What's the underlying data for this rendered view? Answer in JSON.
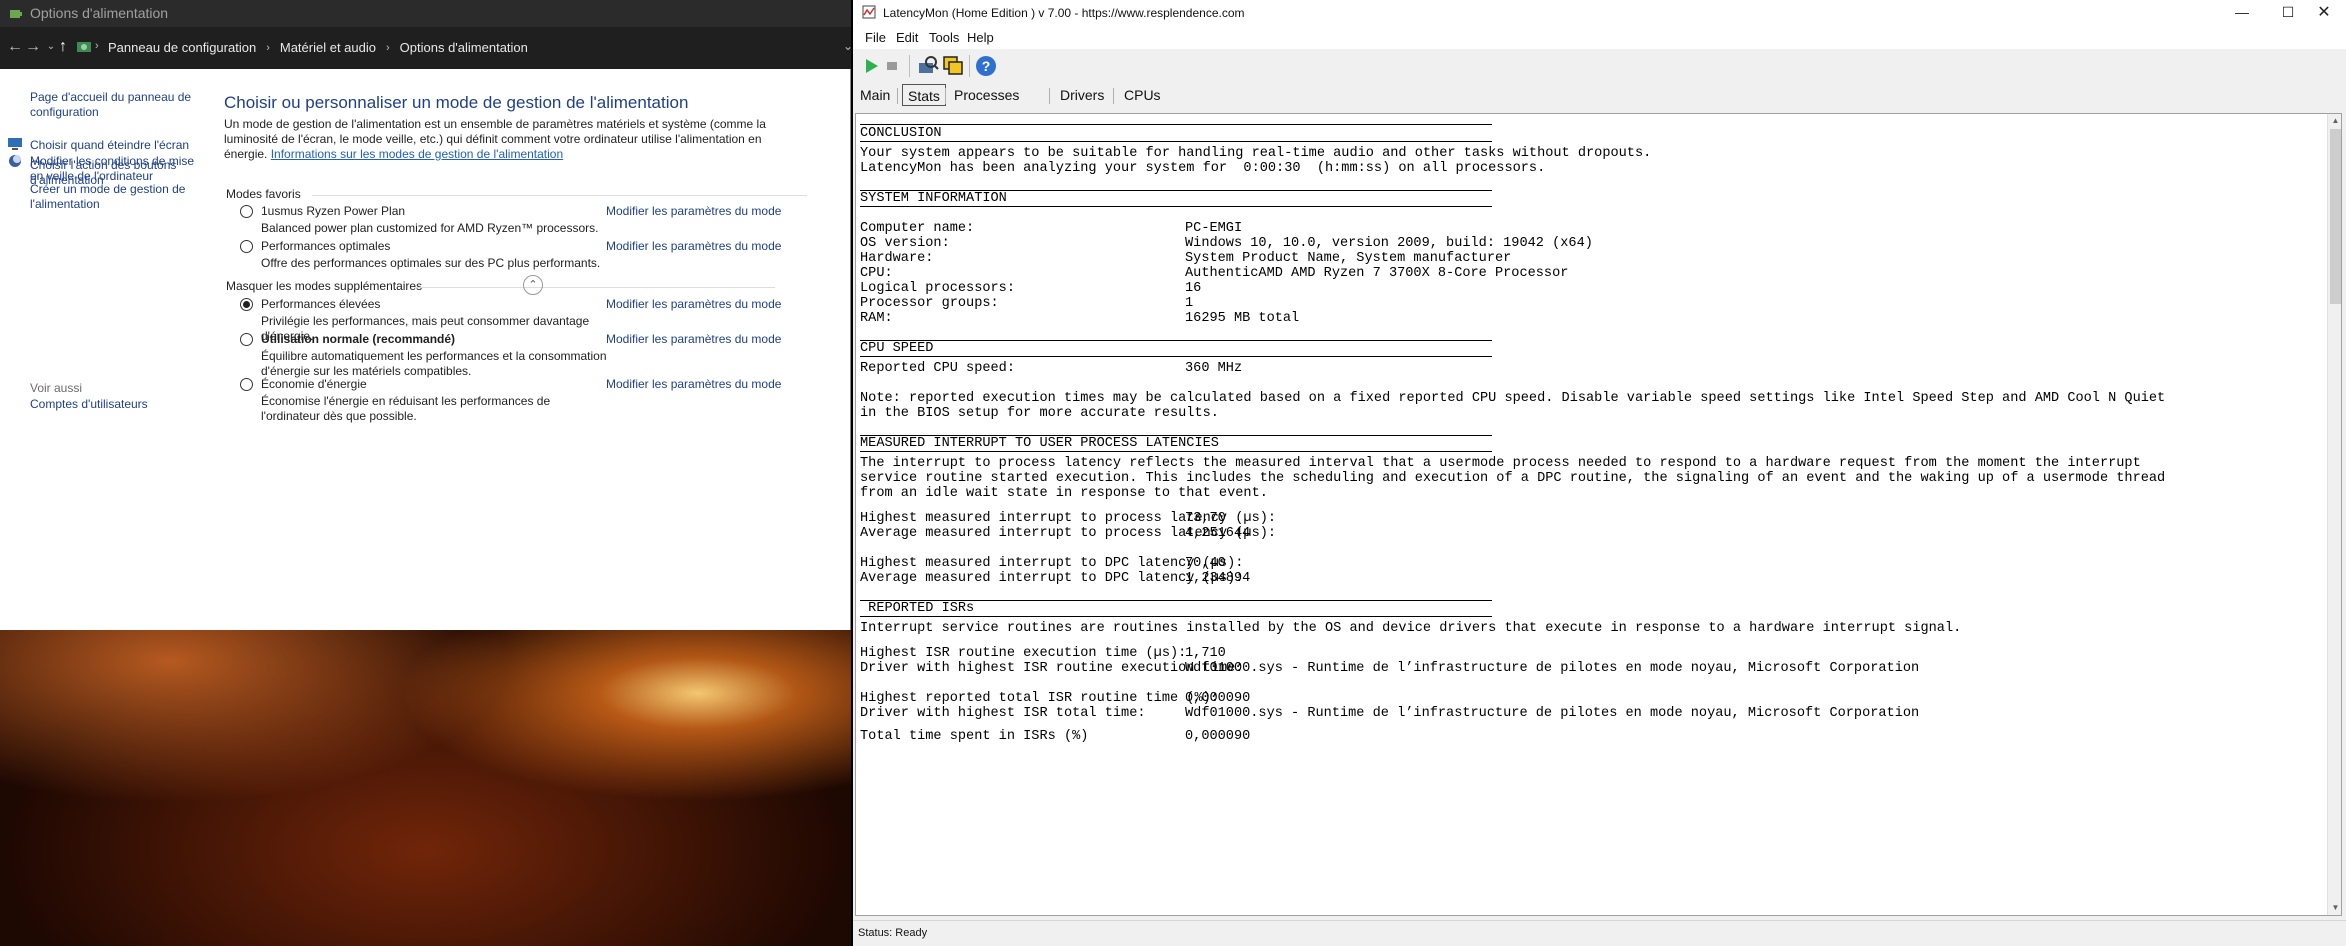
{
  "control_panel": {
    "window_title": "Options d'alimentation",
    "breadcrumb": [
      "Panneau de configuration",
      "Matériel et audio",
      "Options d'alimentation"
    ],
    "sidebar": {
      "links": [
        "Page d'accueil du panneau de configuration",
        "Choisir l'action des boutons d'alimentation",
        "Créer un mode de gestion de l'alimentation",
        "Choisir quand éteindre l'écran",
        "Modifier les conditions de mise en veille de l'ordinateur"
      ],
      "see_also_heading": "Voir aussi",
      "see_also_links": [
        "Comptes d'utilisateurs"
      ]
    },
    "main": {
      "title": "Choisir ou personnaliser un mode de gestion de l'alimentation",
      "intro": "Un mode de gestion de l'alimentation est un ensemble de paramètres matériels et système (comme la luminosité de l'écran, le mode veille, etc.) qui définit comment votre ordinateur utilise l'alimentation en énergie.",
      "intro_link": "Informations sur les modes de gestion de l'alimentation",
      "favorites_heading": "Modes favoris",
      "hide_heading": "Masquer les modes supplémentaires",
      "change_settings_label": "Modifier les paramètres du mode",
      "plans": [
        {
          "name": "1usmus Ryzen Power Plan",
          "description": "Balanced power plan customized for AMD Ryzen™ processors.",
          "selected": false,
          "bold": false
        },
        {
          "name": "Performances optimales",
          "description": "Offre des performances optimales sur des PC plus performants.",
          "selected": false,
          "bold": false
        },
        {
          "name": "Performances élevées",
          "description": "Privilégie les performances, mais peut consommer davantage d'énergie.",
          "selected": true,
          "bold": false
        },
        {
          "name": "Utilisation normale (recommandé)",
          "description": "Équilibre automatiquement les performances et la consommation d'énergie sur les matériels compatibles.",
          "selected": false,
          "bold": true
        },
        {
          "name": "Économie d'énergie",
          "description": "Économise l'énergie en réduisant les performances de l'ordinateur dès que possible.",
          "selected": false,
          "bold": false
        }
      ]
    }
  },
  "latencymon": {
    "window_title": "LatencyMon  (Home Edition )  v 7.00 - https://www.resplendence.com",
    "menu": [
      "File",
      "Edit",
      "Tools",
      "Help"
    ],
    "toolbar_icons": [
      "play-icon",
      "stop-icon",
      "driver-scan-icon",
      "copy-windows-icon",
      "help-icon"
    ],
    "tabs": [
      "Main",
      "Stats",
      "Processes",
      "Drivers",
      "CPUs"
    ],
    "active_tab": "Stats",
    "status": "Status: Ready",
    "report": {
      "conclusion_heading": "CONCLUSION",
      "conclusion_lines": [
        "Your system appears to be suitable for handling real-time audio and other tasks without dropouts.",
        "LatencyMon has been analyzing your system for  0:00:30  (h:mm:ss) on all processors."
      ],
      "system_heading": "SYSTEM INFORMATION",
      "system_info": [
        {
          "key": "Computer name:",
          "value": "PC-EMGI"
        },
        {
          "key": "OS version:",
          "value": "Windows 10, 10.0, version 2009, build: 19042 (x64)"
        },
        {
          "key": "Hardware:",
          "value": "System Product Name, System manufacturer"
        },
        {
          "key": "CPU:",
          "value": "AuthenticAMD AMD Ryzen 7 3700X 8-Core Processor"
        },
        {
          "key": "Logical processors:",
          "value": "16"
        },
        {
          "key": "Processor groups:",
          "value": "1"
        },
        {
          "key": "RAM:",
          "value": "16295 MB total"
        }
      ],
      "cpu_speed_heading": "CPU SPEED",
      "cpu_speed_key": "Reported CPU speed:",
      "cpu_speed_value": "360 MHz",
      "cpu_note_lines": [
        "Note: reported execution times may be calculated based on a fixed reported CPU speed. Disable variable speed settings like Intel Speed Step and AMD Cool N Quiet",
        "in the BIOS setup for more accurate results."
      ],
      "interrupt_heading": "MEASURED INTERRUPT TO USER PROCESS LATENCIES",
      "interrupt_desc_lines": [
        "The interrupt to process latency reflects the measured interval that a usermode process needed to respond to a hardware request from the moment the interrupt",
        "service routine started execution. This includes the scheduling and execution of a DPC routine, the signaling of an event and the waking up of a usermode thread",
        "from an idle wait state in response to that event."
      ],
      "latencies": [
        {
          "key": "Highest measured interrupt to process latency (µs):",
          "value": "73,70"
        },
        {
          "key": "Average measured interrupt to process latency (µs):",
          "value": "4,251644"
        },
        {
          "key": "Highest measured interrupt to DPC latency (µs):",
          "value": "70,40"
        },
        {
          "key": "Average measured interrupt to DPC latency (µs):",
          "value": "1,234894"
        }
      ],
      "isr_heading": " REPORTED ISRs",
      "isr_desc": "Interrupt service routines are routines installed by the OS and device drivers that execute in response to a hardware interrupt signal.",
      "isr_stats": [
        {
          "key": "Highest ISR routine execution time (µs):",
          "value": "1,710"
        },
        {
          "key": "Driver with highest ISR routine execution time:",
          "value": "Wdf01000.sys - Runtime de l’infrastructure de pilotes en mode noyau, Microsoft Corporation"
        },
        {
          "key": "Highest reported total ISR routine time (%):",
          "value": "0,000090"
        },
        {
          "key": "Driver with highest ISR total time:",
          "value": "Wdf01000.sys - Runtime de l’infrastructure de pilotes en mode noyau, Microsoft Corporation"
        },
        {
          "key": "Total time spent in ISRs (%)",
          "value": "0,000090"
        }
      ]
    }
  }
}
